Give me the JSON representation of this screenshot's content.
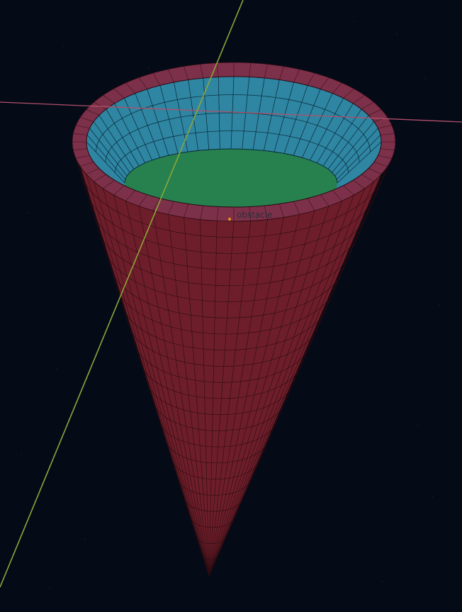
{
  "scene": {
    "object_name": "obstacle",
    "colors": {
      "background": "#050a17",
      "cone_outer": "#6e1e2a",
      "cone_outer_light": "#7c2636",
      "rim": "#7d3049",
      "inner_wall": "#2e86a3",
      "inner_floor": "#26814f",
      "wire": "#2a0c12",
      "axis_x": "#b0506a",
      "axis_y": "#8da63a",
      "origin": "#f08a3a"
    },
    "axes": [
      "x-axis",
      "y-axis"
    ]
  }
}
